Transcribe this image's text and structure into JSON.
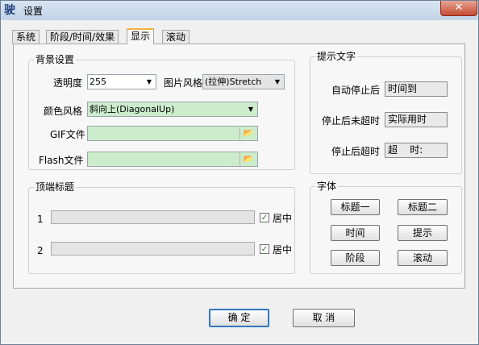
{
  "window": {
    "title": "设置",
    "close_symbol": "✕",
    "app_icon_glyph": "驶"
  },
  "tabs": [
    {
      "label": "系统",
      "active": false
    },
    {
      "label": "阶段/时间/效果",
      "active": false
    },
    {
      "label": "显示",
      "active": true
    },
    {
      "label": "滚动",
      "active": false
    }
  ],
  "background": {
    "title": "背景设置",
    "opacity_label": "透明度",
    "opacity_value": "255",
    "image_style_label": "图片风格",
    "image_style_value": "(拉伸)Stretch",
    "color_style_label": "颜色风格",
    "color_style_value": "斜向上(DiagonalUp)",
    "gif_label": "GIF文件",
    "gif_value": "",
    "flash_label": "Flash文件",
    "flash_value": ""
  },
  "top_title": {
    "title": "顶端标题",
    "rows": [
      {
        "index": "1",
        "value": "",
        "checkbox_label": "居中",
        "checked": true
      },
      {
        "index": "2",
        "value": "",
        "checkbox_label": "居中",
        "checked": true
      }
    ]
  },
  "hint_text": {
    "title": "提示文字",
    "auto_stop_label": "自动停止后",
    "auto_stop_value": "时间到",
    "not_over_label": "停止后未超时",
    "not_over_value": "实际用时",
    "over_label": "停止后超时",
    "over_value": "超    时:"
  },
  "font": {
    "title": "字体",
    "buttons": [
      "标题一",
      "标题二",
      "时间",
      "提示",
      "阶段",
      "滚动"
    ]
  },
  "footer": {
    "ok_label": "确 定",
    "cancel_label": "取 消"
  },
  "colors": {
    "accent": "#2f78c4",
    "field_green": "#cceccc",
    "tab_highlight": "#f1b33c"
  }
}
